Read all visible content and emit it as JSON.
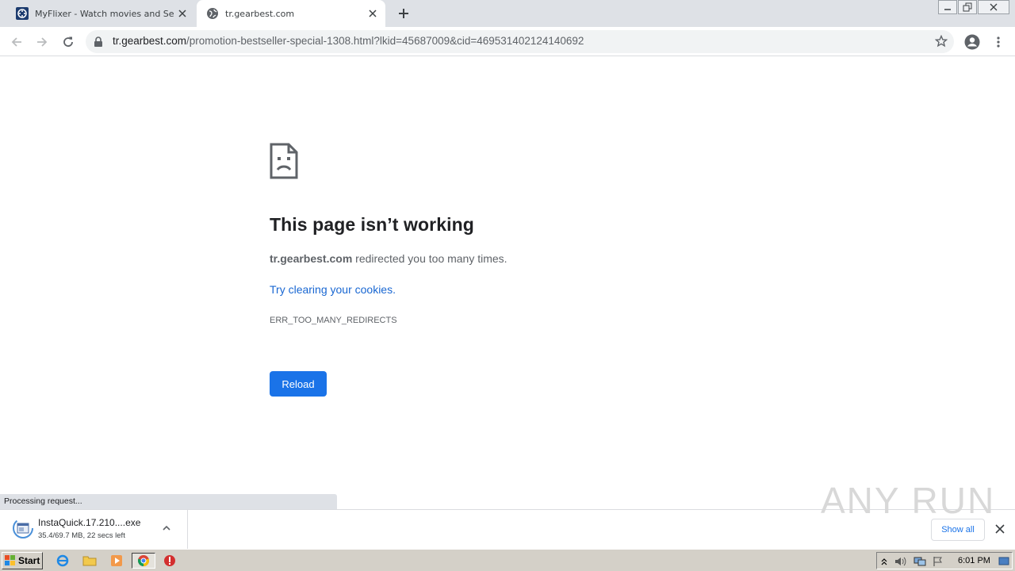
{
  "browser": {
    "tabs": [
      {
        "title": "MyFlixer - Watch movies and Series",
        "icon": "film-reel-icon",
        "active": false
      },
      {
        "title": "tr.gearbest.com",
        "icon": "globe-icon",
        "active": true
      }
    ],
    "url_host": "tr.gearbest.com",
    "url_path": "/promotion-bestseller-special-1308.html?lkid=45687009&cid=469531402124140692"
  },
  "error": {
    "icon": "sad-page-icon",
    "title": "This page isn’t working",
    "host": "tr.gearbest.com",
    "message": " redirected you too many times.",
    "link": "Try clearing your cookies.",
    "code": "ERR_TOO_MANY_REDIRECTS",
    "button": "Reload"
  },
  "status_bubble": "Processing request...",
  "download": {
    "filename": "InstaQuick.17.210....exe",
    "status": "35.4/69.7 MB, 22 secs left",
    "show_all": "Show all"
  },
  "watermark": "ANY RUN",
  "taskbar": {
    "start": "Start",
    "clock": "6:01 PM"
  },
  "colors": {
    "accent": "#1a73e8",
    "link": "#1967d2",
    "tabstrip": "#dee1e6",
    "taskbar": "#d4d0c8"
  }
}
